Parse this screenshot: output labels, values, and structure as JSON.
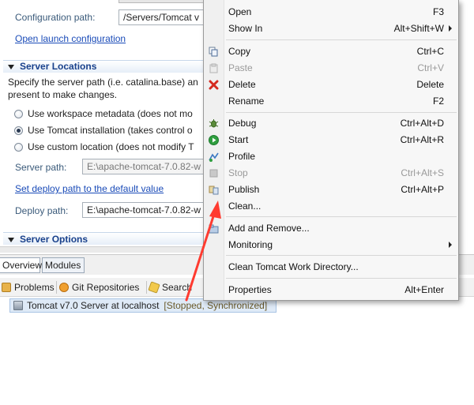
{
  "editor": {
    "config_path_label": "Configuration path:",
    "config_path_value": "/Servers/Tomcat v",
    "open_launch_link": "Open launch configuration",
    "server_locations": {
      "title": "Server Locations",
      "desc_line1": "Specify the server path (i.e. catalina.base) an",
      "desc_line2": "present to make changes.",
      "options": [
        "Use workspace metadata (does not mo",
        "Use Tomcat installation (takes control o",
        "Use custom location (does not modify T"
      ],
      "selected_index": 1,
      "server_path_label": "Server path:",
      "server_path_value": "E:\\apache-tomcat-7.0.82-w",
      "set_deploy_link": "Set deploy path to the default value",
      "deploy_path_label": "Deploy path:",
      "deploy_path_value": "E:\\apache-tomcat-7.0.82-w"
    },
    "server_options_title": "Server Options"
  },
  "editor_tabs": [
    "Overview",
    "Modules"
  ],
  "views": {
    "tabs": [
      "Problems",
      "Git Repositories",
      "Search"
    ]
  },
  "servers": [
    {
      "name": "Tomcat v7.0 Server at localhost",
      "status": "[Stopped, Synchronized]"
    }
  ],
  "context_menu": {
    "groups": [
      [
        {
          "label": "Open",
          "shortcut": "F3",
          "enabled": true,
          "icon": ""
        },
        {
          "label": "Show In",
          "shortcut": "Alt+Shift+W",
          "enabled": true,
          "submenu": true,
          "icon": ""
        }
      ],
      [
        {
          "label": "Copy",
          "shortcut": "Ctrl+C",
          "enabled": true,
          "icon": "copy-icon"
        },
        {
          "label": "Paste",
          "shortcut": "Ctrl+V",
          "enabled": false,
          "icon": "paste-icon"
        },
        {
          "label": "Delete",
          "shortcut": "Delete",
          "enabled": true,
          "icon": "delete-icon"
        },
        {
          "label": "Rename",
          "shortcut": "F2",
          "enabled": true,
          "icon": ""
        }
      ],
      [
        {
          "label": "Debug",
          "shortcut": "Ctrl+Alt+D",
          "enabled": true,
          "icon": "debug-icon"
        },
        {
          "label": "Start",
          "shortcut": "Ctrl+Alt+R",
          "enabled": true,
          "icon": "start-icon"
        },
        {
          "label": "Profile",
          "shortcut": "",
          "enabled": true,
          "icon": "profile-icon"
        },
        {
          "label": "Stop",
          "shortcut": "Ctrl+Alt+S",
          "enabled": false,
          "icon": "stop-icon"
        },
        {
          "label": "Publish",
          "shortcut": "Ctrl+Alt+P",
          "enabled": true,
          "icon": "publish-icon"
        },
        {
          "label": "Clean...",
          "shortcut": "",
          "enabled": true,
          "icon": ""
        }
      ],
      [
        {
          "label": "Add and Remove...",
          "shortcut": "",
          "enabled": true,
          "icon": "add-remove-icon"
        },
        {
          "label": "Monitoring",
          "shortcut": "",
          "enabled": true,
          "submenu": true,
          "icon": ""
        }
      ],
      [
        {
          "label": "Clean Tomcat Work Directory...",
          "shortcut": "",
          "enabled": true,
          "icon": ""
        }
      ],
      [
        {
          "label": "Properties",
          "shortcut": "Alt+Enter",
          "enabled": true,
          "icon": ""
        }
      ]
    ]
  },
  "annotation": {
    "color": "#ff3b30",
    "icon": "arrow-annotation"
  }
}
